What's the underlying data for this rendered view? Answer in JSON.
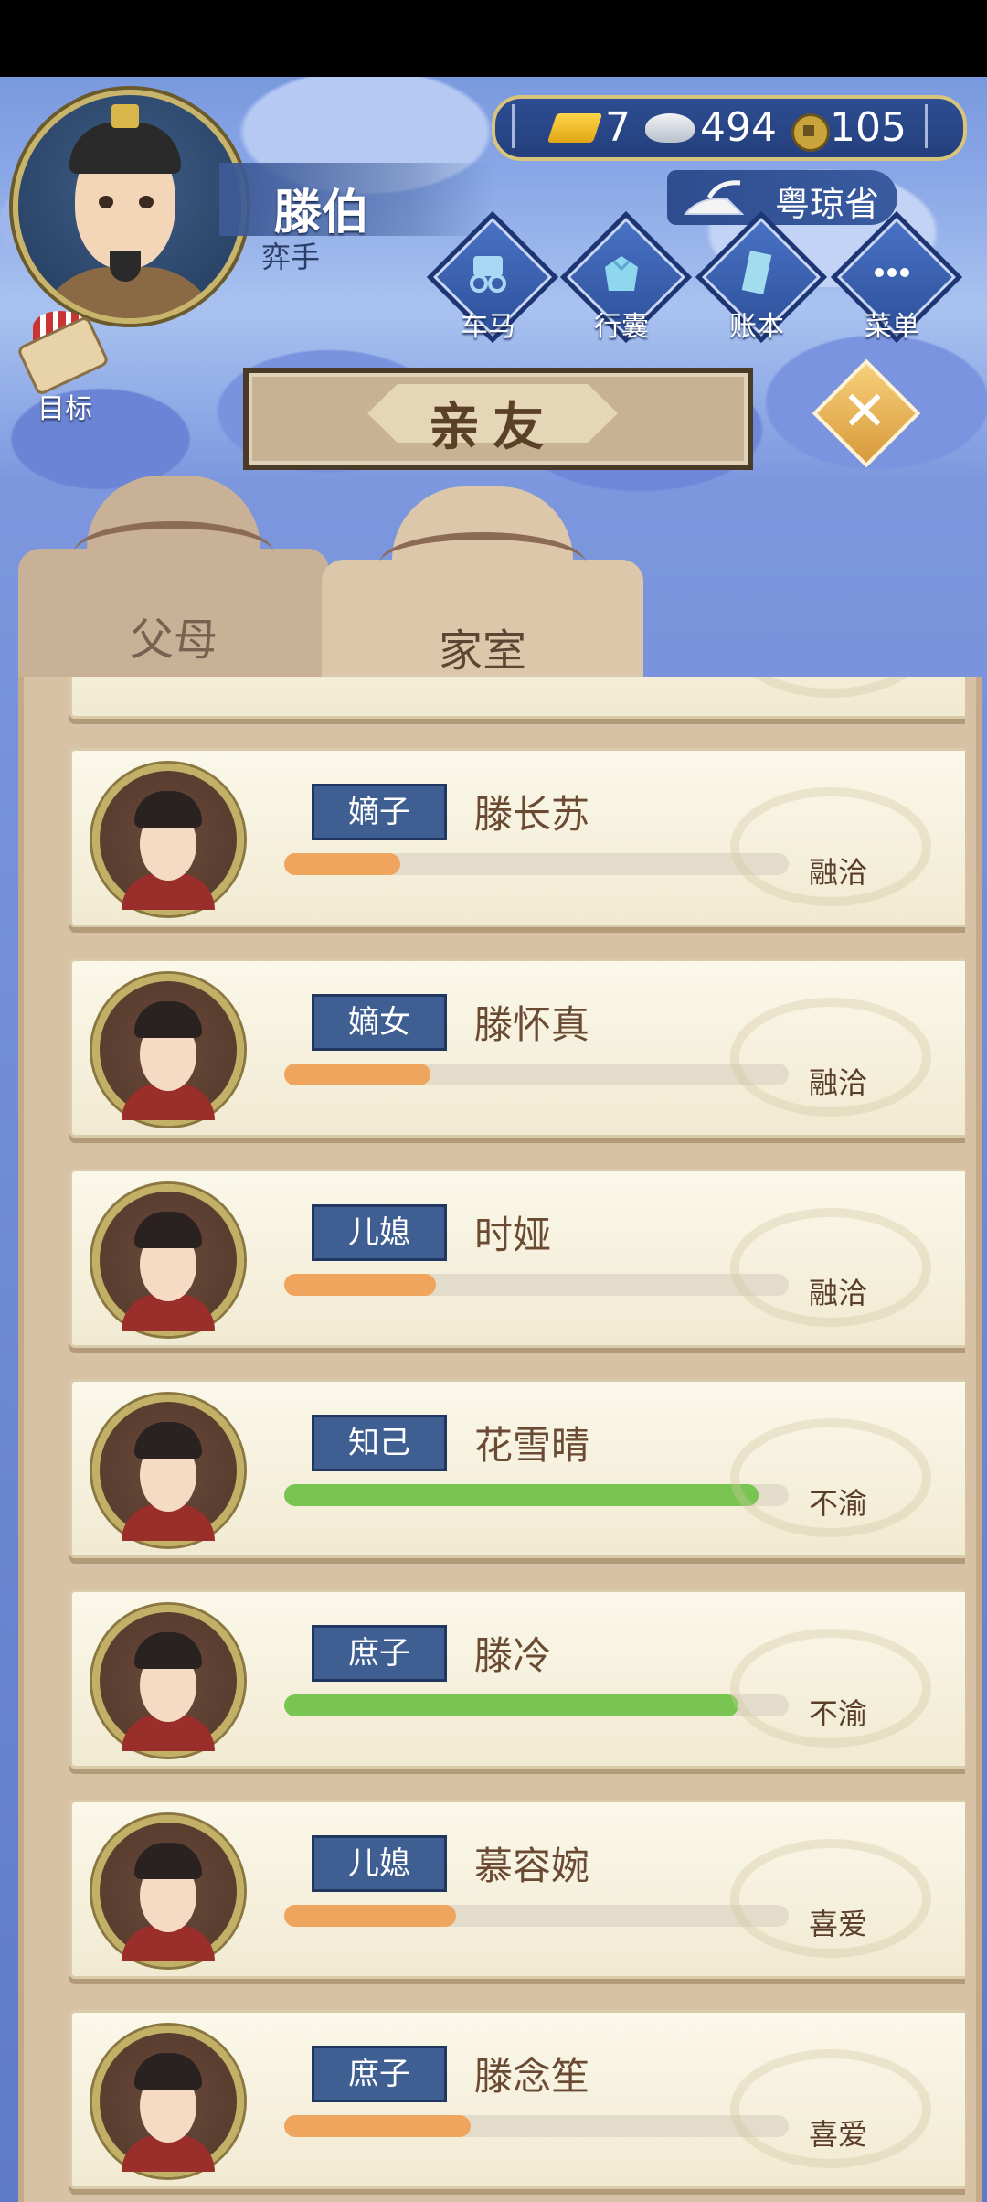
{
  "player": {
    "name": "滕伯",
    "title": "弈手"
  },
  "currency": {
    "gold": "7",
    "silver": "494",
    "coins": "105"
  },
  "province": "粤琼省",
  "menu": [
    "车马",
    "行囊",
    "账本",
    "菜单"
  ],
  "goal_label": "目标",
  "page_title": "亲友",
  "tabs": [
    "父母",
    "家室"
  ],
  "members": [
    {
      "role": "嫡子",
      "name": "滕长苏",
      "status": "融洽",
      "level": 0.23,
      "bar_color": "#f0a55e"
    },
    {
      "role": "嫡女",
      "name": "滕怀真",
      "status": "融洽",
      "level": 0.29,
      "bar_color": "#f0a55e"
    },
    {
      "role": "儿媳",
      "name": "时娅",
      "status": "融洽",
      "level": 0.3,
      "bar_color": "#f0a55e"
    },
    {
      "role": "知己",
      "name": "花雪晴",
      "status": "不渝",
      "level": 0.94,
      "bar_color": "#78c651"
    },
    {
      "role": "庶子",
      "name": "滕冷",
      "status": "不渝",
      "level": 0.9,
      "bar_color": "#78c651"
    },
    {
      "role": "儿媳",
      "name": "慕容婉",
      "status": "喜爱",
      "level": 0.34,
      "bar_color": "#f0a55e"
    },
    {
      "role": "庶子",
      "name": "滕念笙",
      "status": "喜爱",
      "level": 0.37,
      "bar_color": "#f0a55e"
    }
  ]
}
